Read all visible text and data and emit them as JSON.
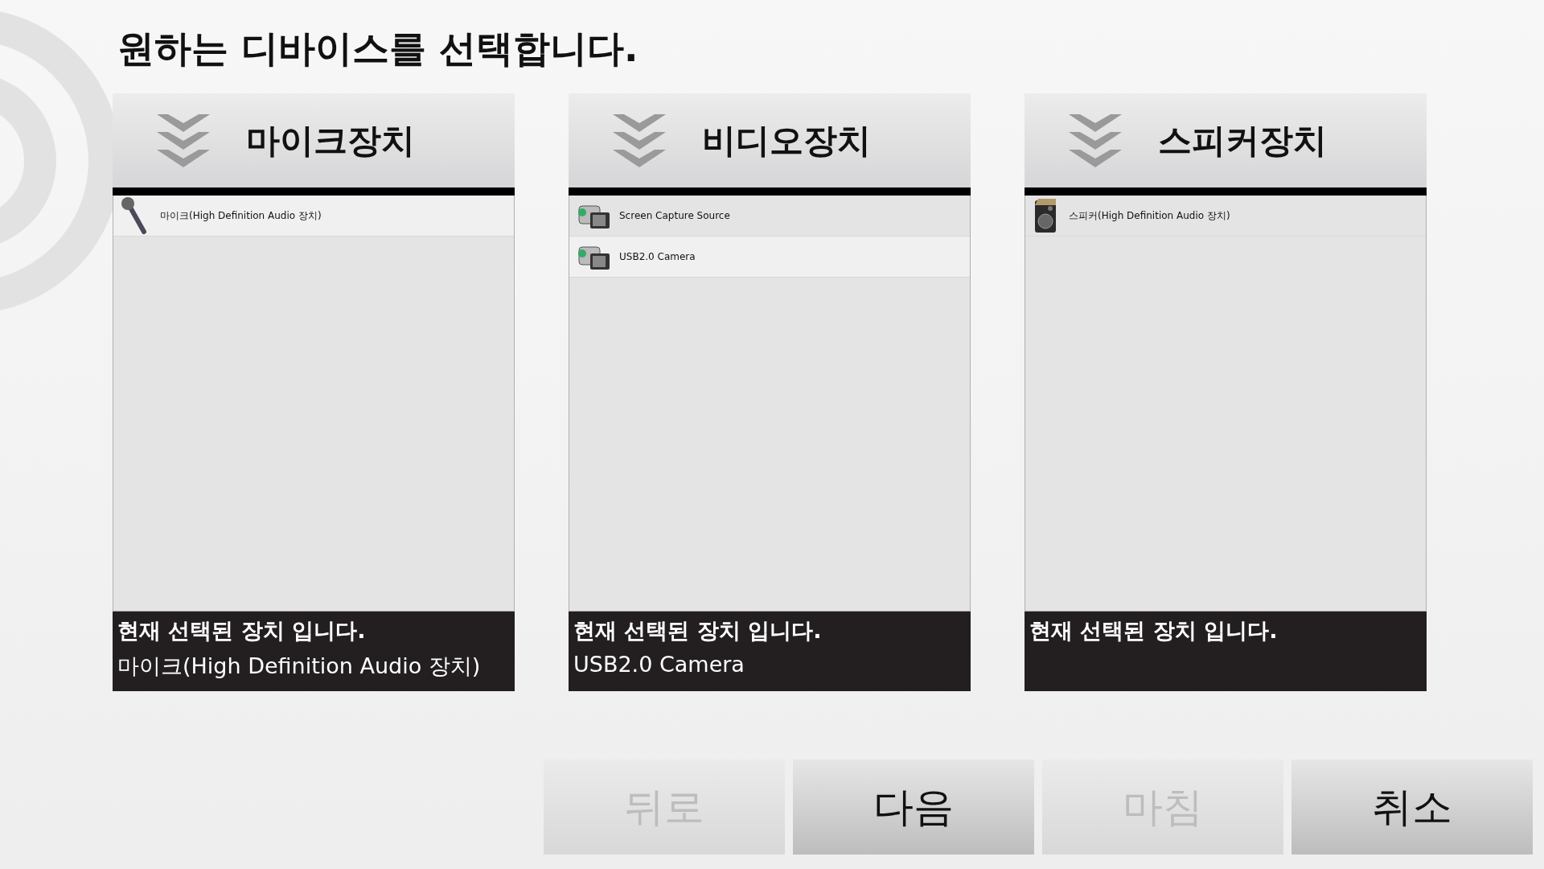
{
  "title": "원하는 디바이스를 선택합니다.",
  "panels": [
    {
      "heading": "마이크장치",
      "devices": [
        {
          "kind": "microphone",
          "name": "마이크(High Definition Audio 장치)",
          "selected": true
        }
      ],
      "footer_label": "현재 선택된 장치 입니다.",
      "current": "마이크(High Definition Audio 장치)"
    },
    {
      "heading": "비디오장치",
      "devices": [
        {
          "kind": "camera",
          "name": "Screen Capture Source",
          "selected": false
        },
        {
          "kind": "camera",
          "name": "USB2.0 Camera",
          "selected": true
        }
      ],
      "footer_label": "현재 선택된 장치 입니다.",
      "current": "USB2.0 Camera"
    },
    {
      "heading": "스피커장치",
      "devices": [
        {
          "kind": "speaker",
          "name": "스피커(High Definition Audio 장치)",
          "selected": false
        }
      ],
      "footer_label": "현재 선택된 장치 입니다."
    }
  ],
  "buttons": [
    {
      "label": "뒤로",
      "disabled": true
    },
    {
      "label": "다음",
      "disabled": false
    },
    {
      "label": "마침",
      "disabled": true
    },
    {
      "label": "취소",
      "disabled": false
    }
  ]
}
